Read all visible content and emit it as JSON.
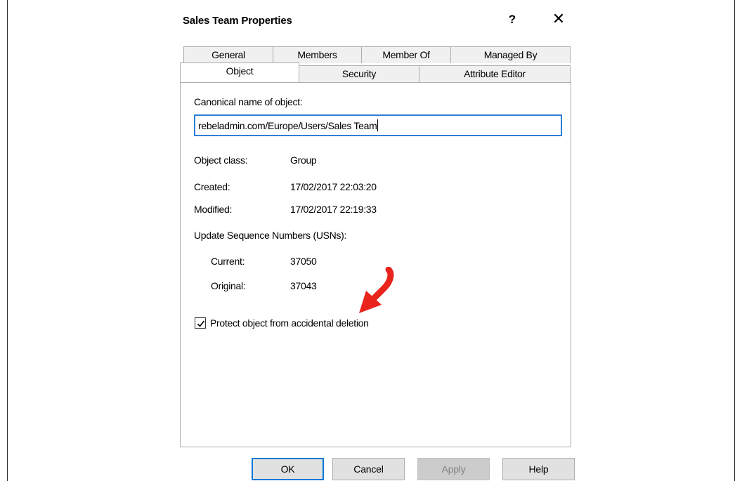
{
  "dialog": {
    "title": "Sales Team Properties",
    "help_glyph": "?",
    "close_glyph": "✕"
  },
  "tabs": {
    "row1": [
      "General",
      "Members",
      "Member Of",
      "Managed By"
    ],
    "row2": [
      "Object",
      "Security",
      "Attribute Editor"
    ],
    "active": "Object"
  },
  "object_tab": {
    "canonical_label": "Canonical name of object:",
    "canonical_value": "rebeladmin.com/Europe/Users/Sales Team",
    "object_class_label": "Object class:",
    "object_class_value": "Group",
    "created_label": "Created:",
    "created_value": "17/02/2017 22:03:20",
    "modified_label": "Modified:",
    "modified_value": "17/02/2017 22:19:33",
    "usn_heading": "Update Sequence Numbers (USNs):",
    "current_label": "Current:",
    "current_value": "37050",
    "original_label": "Original:",
    "original_value": "37043",
    "protect_label": "Protect object from accidental deletion",
    "protect_checked": true
  },
  "buttons": {
    "ok": "OK",
    "cancel": "Cancel",
    "apply": "Apply",
    "help": "Help"
  },
  "colors": {
    "annotation_arrow": "#e8241c",
    "focus_blue": "#0078d7"
  }
}
